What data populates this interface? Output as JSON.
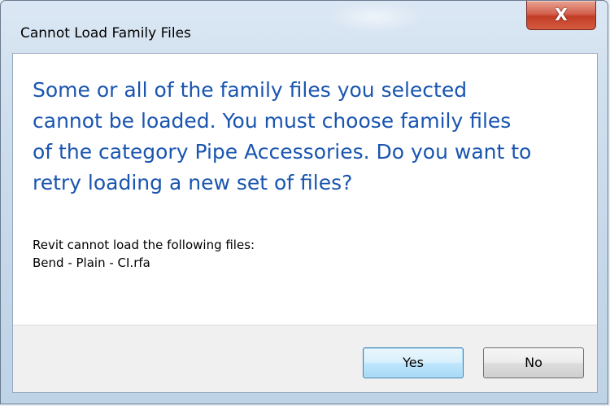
{
  "window": {
    "title": "Cannot Load Family Files",
    "close_glyph": "X"
  },
  "message": {
    "main_lines": [
      "Some or all of the family files you selected",
      "cannot be loaded. You must choose family files",
      "of the category Pipe Accessories. Do you want to",
      "retry loading a new set of files?"
    ],
    "detail_lines": [
      "Revit cannot load the following files:",
      "Bend - Plain - CI.rfa"
    ]
  },
  "buttons": {
    "yes_label": "Yes",
    "no_label": "No"
  },
  "colors": {
    "instruction_text": "#1a55b0",
    "close_button": "#c23d26"
  },
  "icons": {
    "close": "close-icon"
  }
}
